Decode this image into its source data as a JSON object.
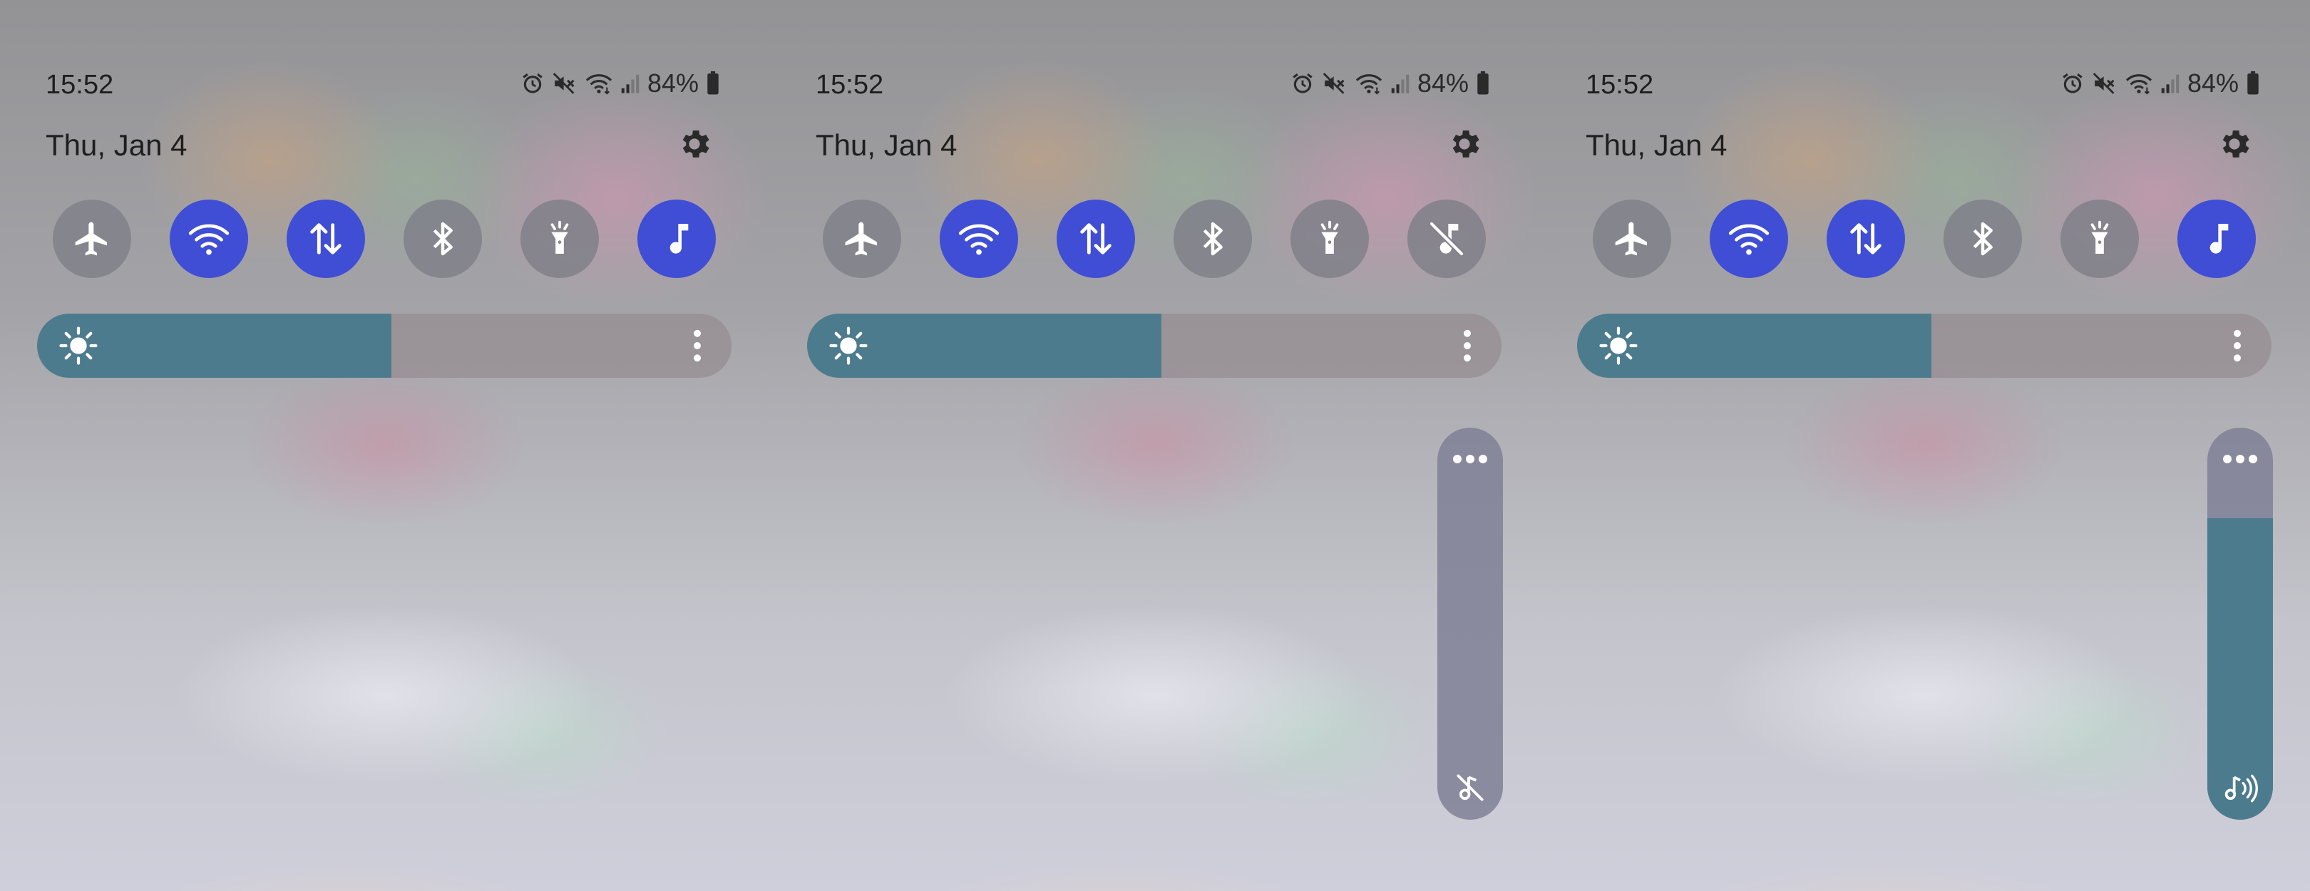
{
  "colors": {
    "tile_on": "#3f4ed4",
    "tile_off": "#80808a",
    "brightness_fill": "#4d7b8e",
    "volume_fill": "#4d7b8e"
  },
  "panels": [
    {
      "status": {
        "time": "15:52",
        "battery": "84%",
        "icons": [
          "alarm-icon",
          "mute-icon",
          "wifi-icon",
          "signal-icon",
          "battery-icon"
        ]
      },
      "date": "Thu, Jan 4",
      "tiles": [
        {
          "name": "airplane",
          "active": false
        },
        {
          "name": "wifi",
          "active": true
        },
        {
          "name": "mobile-data",
          "active": true
        },
        {
          "name": "bluetooth",
          "active": false
        },
        {
          "name": "flashlight",
          "active": false
        },
        {
          "name": "sound-mode",
          "active": true
        }
      ],
      "brightness_level": 0.51,
      "volume_slider": null
    },
    {
      "status": {
        "time": "15:52",
        "battery": "84%",
        "icons": [
          "alarm-icon",
          "mute-icon",
          "wifi-icon",
          "signal-icon",
          "battery-icon"
        ]
      },
      "date": "Thu, Jan 4",
      "tiles": [
        {
          "name": "airplane",
          "active": false
        },
        {
          "name": "wifi",
          "active": true
        },
        {
          "name": "mobile-data",
          "active": true
        },
        {
          "name": "bluetooth",
          "active": false
        },
        {
          "name": "flashlight",
          "active": false
        },
        {
          "name": "sound-mode",
          "active": false
        }
      ],
      "brightness_level": 0.51,
      "volume_slider": {
        "level": 0,
        "icon": "music-muted-icon"
      }
    },
    {
      "status": {
        "time": "15:52",
        "battery": "84%",
        "icons": [
          "alarm-icon",
          "mute-icon",
          "wifi-icon",
          "signal-icon",
          "battery-icon"
        ]
      },
      "date": "Thu, Jan 4",
      "tiles": [
        {
          "name": "airplane",
          "active": false
        },
        {
          "name": "wifi",
          "active": true
        },
        {
          "name": "mobile-data",
          "active": true
        },
        {
          "name": "bluetooth",
          "active": false
        },
        {
          "name": "flashlight",
          "active": false
        },
        {
          "name": "sound-mode",
          "active": true
        }
      ],
      "brightness_level": 0.51,
      "volume_slider": {
        "level": 0.77,
        "icon": "music-volume-icon"
      }
    }
  ]
}
